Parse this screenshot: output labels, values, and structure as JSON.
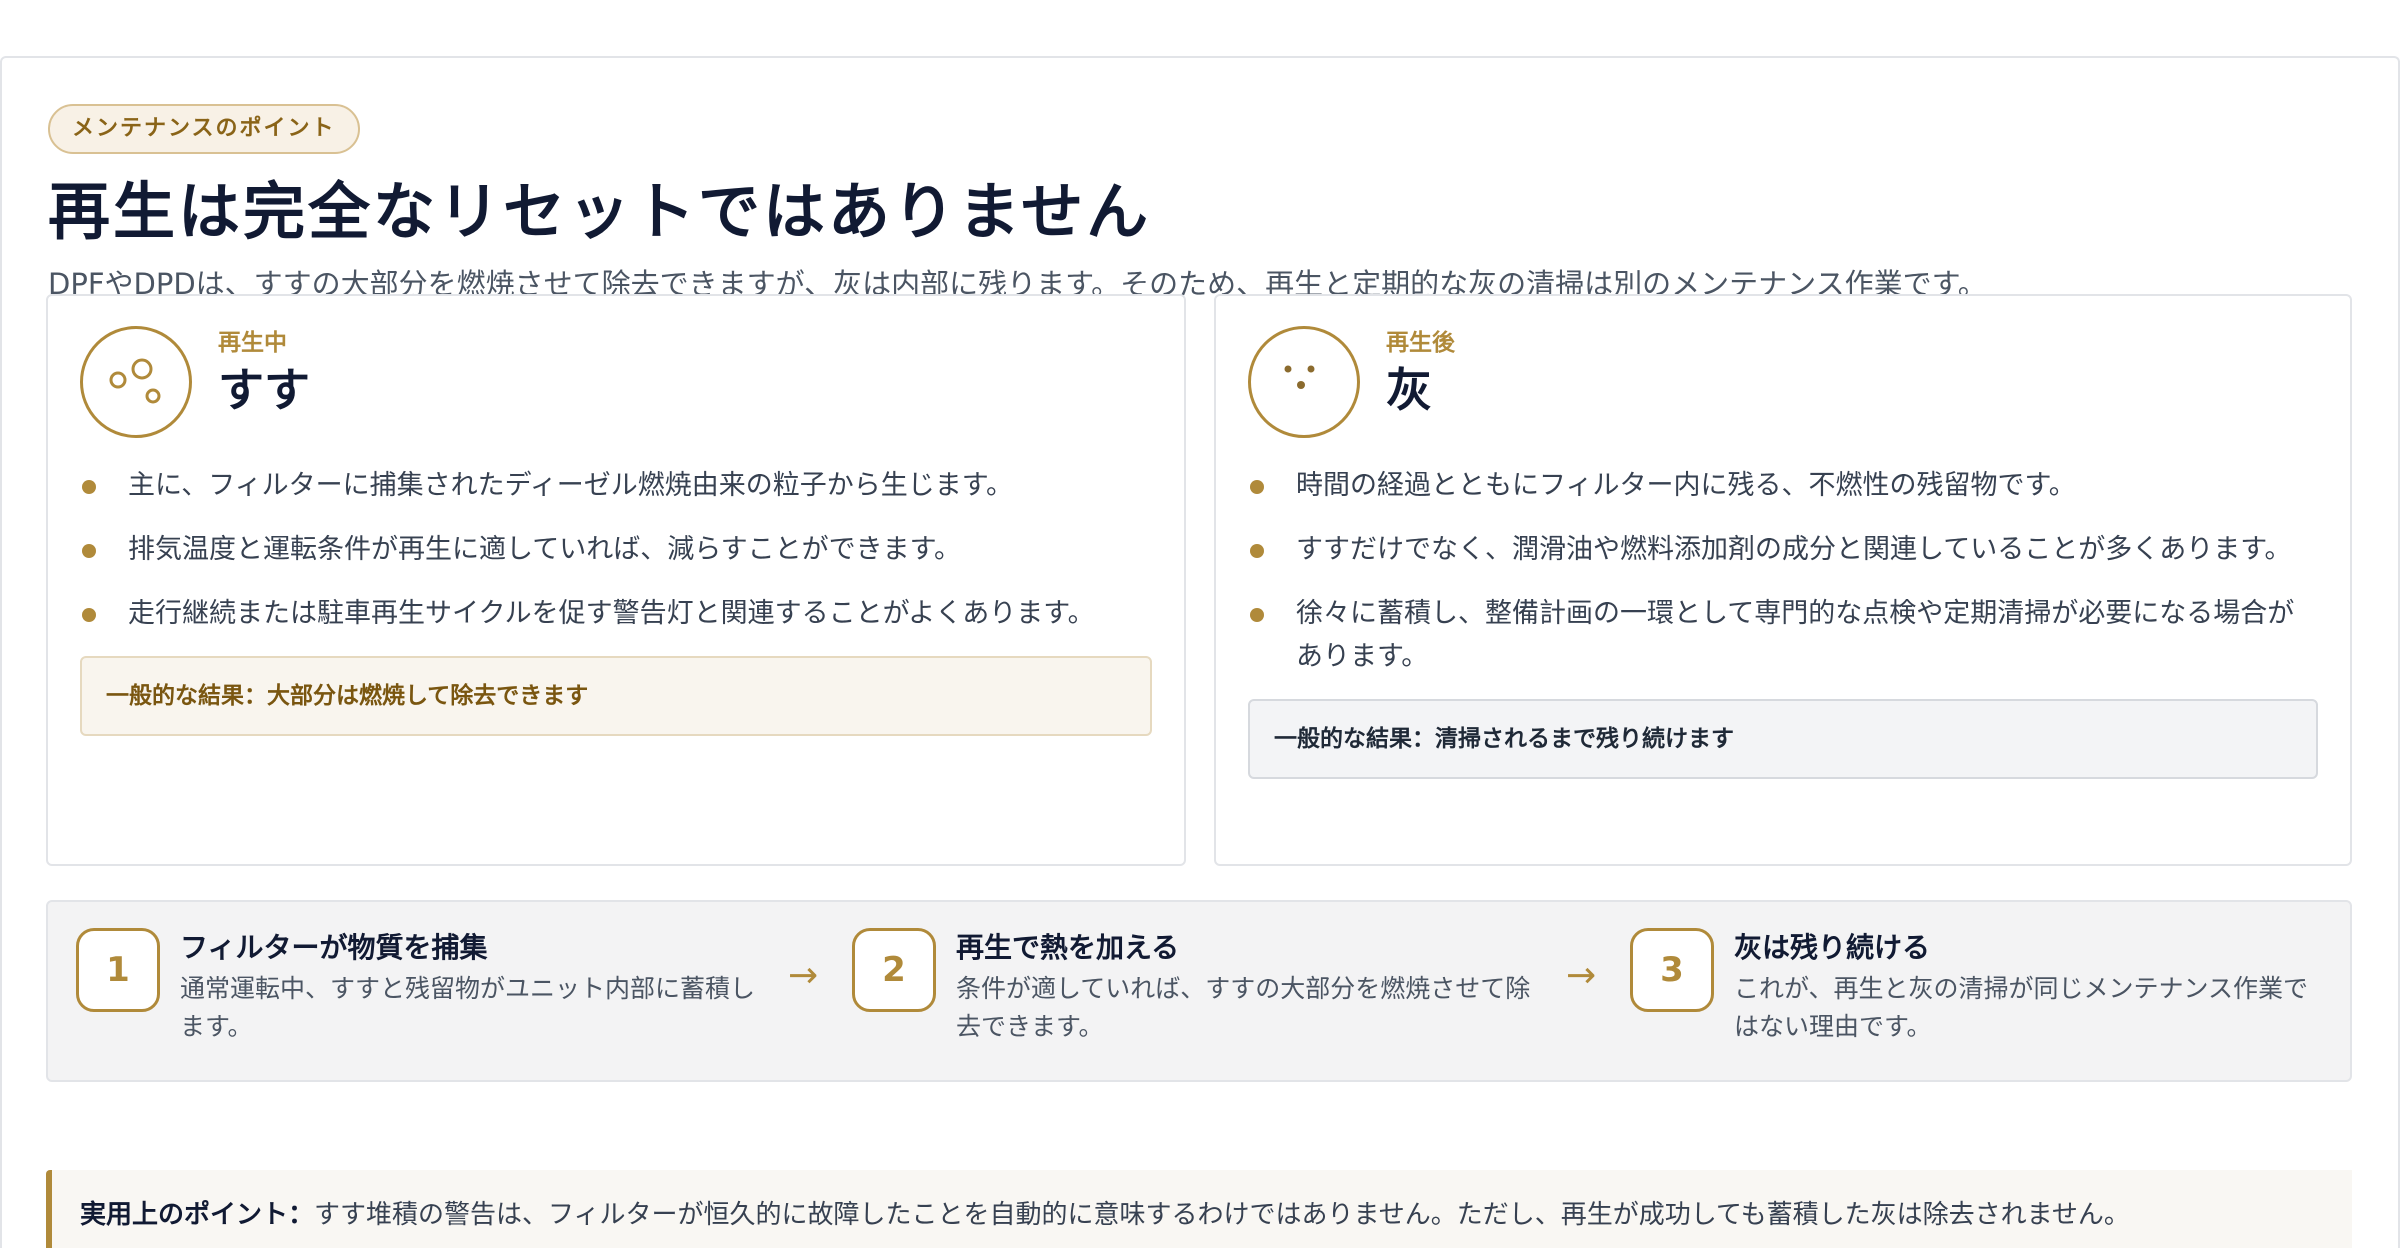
{
  "header": {
    "badge": "メンテナンスのポイント",
    "title": "再生は完全なリセットではありません",
    "lead": "DPFやDPDは、すすの大部分を燃焼させて除去できますが、灰は内部に残ります。そのため、再生と定期的な灰の清掃は別のメンテナンス作業です。"
  },
  "cards": [
    {
      "kicker": "再生中",
      "title": "すす",
      "icon": "soot-particles-icon",
      "bullets": [
        "主に、フィルターに捕集されたディーゼル燃焼由来の粒子から生じます。",
        "排気温度と運転条件が再生に適していれば、減らすことができます。",
        "走行継続または駐車再生サイクルを促す警告灯と関連することがよくあります。"
      ],
      "result": "一般的な結果：大部分は燃焼して除去できます"
    },
    {
      "kicker": "再生後",
      "title": "灰",
      "icon": "ash-residue-icon",
      "bullets": [
        "時間の経過とともにフィルター内に残る、不燃性の残留物です。",
        "すすだけでなく、潤滑油や燃料添加剤の成分と関連していることが多くあります。",
        "徐々に蓄積し、整備計画の一環として専門的な点検や定期清掃が必要になる場合があります。"
      ],
      "result": "一般的な結果：清掃されるまで残り続けます"
    }
  ],
  "steps": [
    {
      "num": "1",
      "title": "フィルターが物質を捕集",
      "desc": "通常運転中、すすと残留物がユニット内部に蓄積します。"
    },
    {
      "num": "2",
      "title": "再生で熱を加える",
      "desc": "条件が適していれば、すすの大部分を燃焼させて除去できます。"
    },
    {
      "num": "3",
      "title": "灰は残り続ける",
      "desc": "これが、再生と灰の清掃が同じメンテナンス作業ではない理由です。"
    }
  ],
  "arrow": "→",
  "note": {
    "label": "実用上のポイント：",
    "text": "すす堆積の警告は、フィルターが恒久的に故障したことを自動的に意味するわけではありません。ただし、再生が成功しても蓄積した灰は除去されません。"
  },
  "colors": {
    "accent": "#b08a3a",
    "title": "#111a33",
    "text": "#374151"
  }
}
